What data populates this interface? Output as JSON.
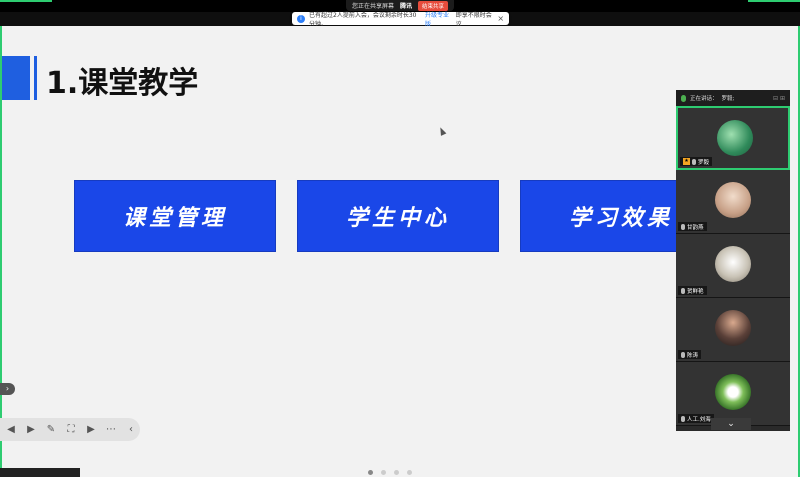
{
  "share_bar": {
    "status_text": "您正在共享屏幕",
    "meeting_label": "腾讯",
    "end_button": "结束共享"
  },
  "notice": {
    "text": "已有超过2人提前入会，会议剩余时长30分钟。",
    "link": "升级专业版",
    "tail": "即享不限时会议",
    "close": "×"
  },
  "slide": {
    "title": "1.课堂教学",
    "cards": [
      "课堂管理",
      "学生中心",
      "学习效果"
    ],
    "accent_color": "#1a47e8"
  },
  "panel": {
    "speaking_label": "正在讲话：",
    "speaking_name": "罗毅;",
    "participants": [
      {
        "name": "罗毅",
        "host": true,
        "avatar_color": "#3a9a6a"
      },
      {
        "name": "甘韵燕",
        "host": false,
        "avatar_color": "#d7b7a0"
      },
      {
        "name": "贺鲜艳",
        "host": false,
        "avatar_color": "#bcb6a8"
      },
      {
        "name": "陈涛",
        "host": false,
        "avatar_color": "#5a4038"
      },
      {
        "name": "人工.刘海",
        "host": false,
        "avatar_color": "#4e8a3a"
      }
    ]
  },
  "toolbar": {
    "prev": "◀",
    "next": "▶",
    "pen": "✎",
    "capture": "⛶",
    "video": "▶",
    "more": "⋯",
    "collapse": "‹"
  },
  "left_handle": "›",
  "scroll_down": "⌄"
}
